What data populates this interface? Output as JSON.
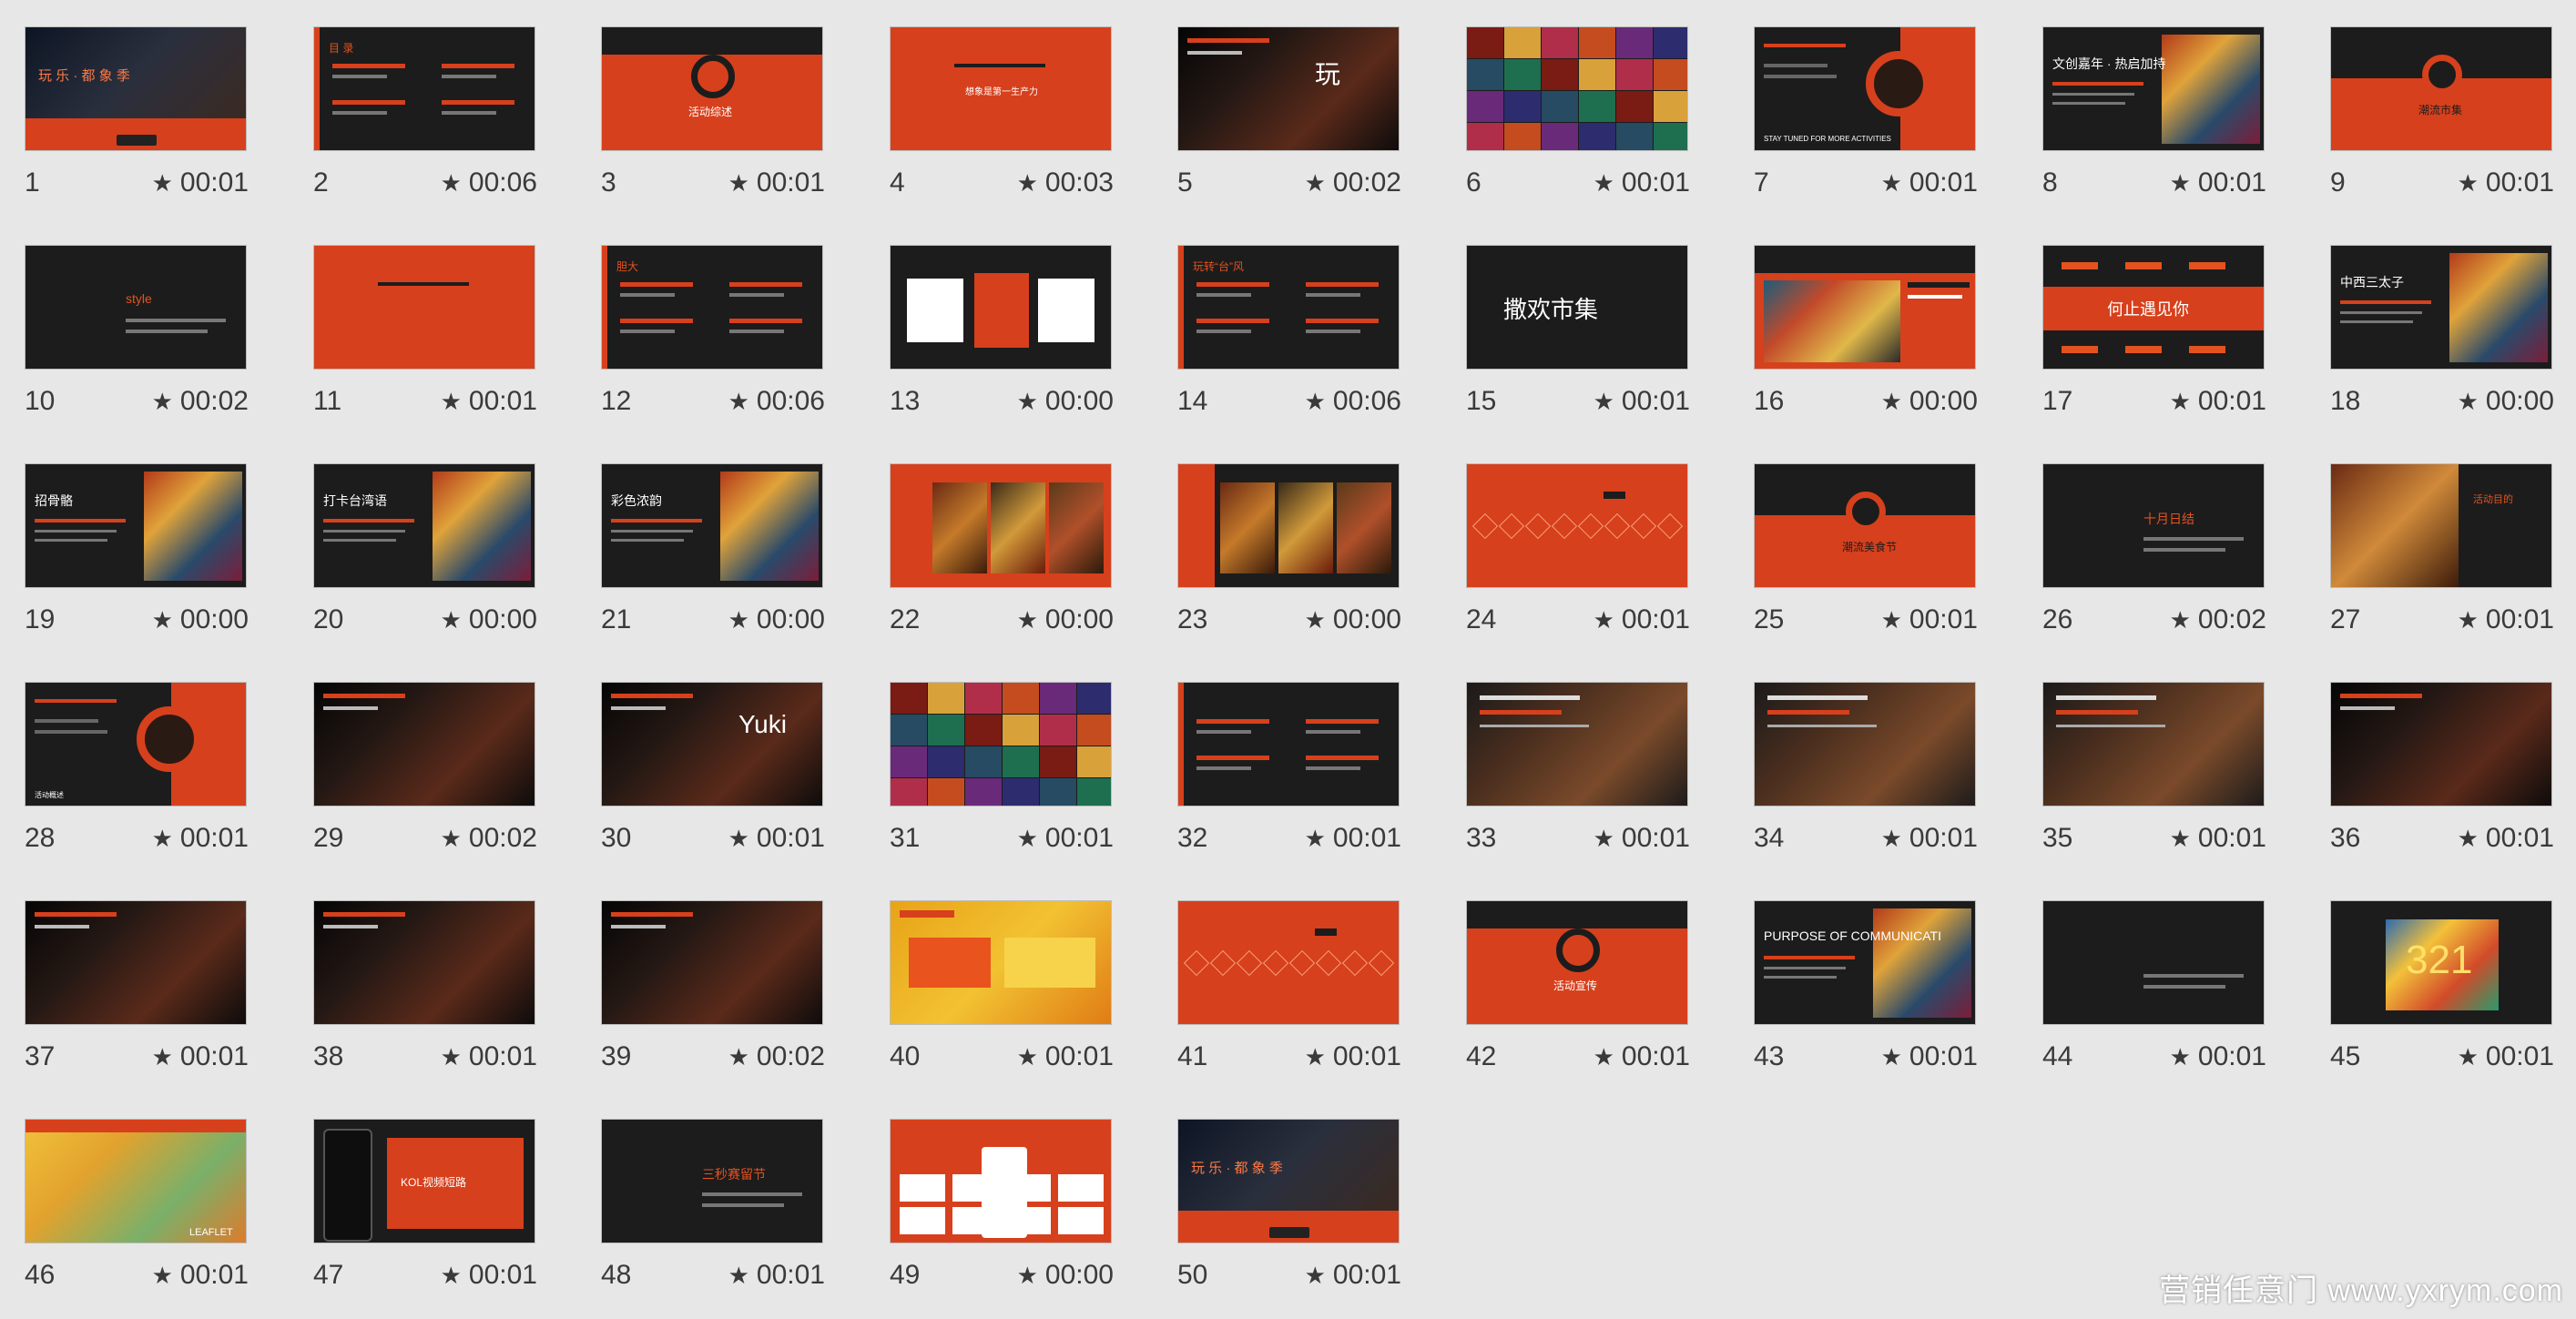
{
  "watermark": "营销任意门 www.yxrym.com",
  "slides": [
    {
      "n": "1",
      "time": "00:01",
      "style": "hero",
      "text": "玩 乐 · 都 象 季"
    },
    {
      "n": "2",
      "time": "00:06",
      "style": "dark-list",
      "text": "目 录"
    },
    {
      "n": "3",
      "time": "00:01",
      "style": "orange-ring",
      "text": "活动综述"
    },
    {
      "n": "4",
      "time": "00:03",
      "style": "orange-title",
      "text": "想象是第一生产力"
    },
    {
      "n": "5",
      "time": "00:02",
      "style": "night",
      "text": "玩"
    },
    {
      "n": "6",
      "time": "00:01",
      "style": "collage",
      "text": ""
    },
    {
      "n": "7",
      "time": "00:01",
      "style": "dark-ring",
      "text": "STAY TUNED FOR MORE ACTIVITIES"
    },
    {
      "n": "8",
      "time": "00:01",
      "style": "dark-photo",
      "text": "文创嘉年 · 热启加持"
    },
    {
      "n": "9",
      "time": "00:01",
      "style": "dark-ring-center",
      "text": "潮流市集"
    },
    {
      "n": "10",
      "time": "00:02",
      "style": "dark-arc",
      "text": "style"
    },
    {
      "n": "11",
      "time": "00:01",
      "style": "orange-title",
      "text": ""
    },
    {
      "n": "12",
      "time": "00:06",
      "style": "dark-list",
      "text": "胆大"
    },
    {
      "n": "13",
      "time": "00:00",
      "style": "cards",
      "text": ""
    },
    {
      "n": "14",
      "time": "00:06",
      "style": "dark-list",
      "text": "玩转“台”风"
    },
    {
      "n": "15",
      "time": "00:01",
      "style": "logo",
      "text": "撒欢市集"
    },
    {
      "n": "16",
      "time": "00:00",
      "style": "orange-photo",
      "text": ""
    },
    {
      "n": "17",
      "time": "00:01",
      "style": "words",
      "text": "何止遇见你"
    },
    {
      "n": "18",
      "time": "00:00",
      "style": "dark-photo-r",
      "text": "中西三太子"
    },
    {
      "n": "19",
      "time": "00:00",
      "style": "dark-photo-r",
      "text": "招骨骼"
    },
    {
      "n": "20",
      "time": "00:00",
      "style": "dark-photo-r",
      "text": "打卡台湾语"
    },
    {
      "n": "21",
      "time": "00:00",
      "style": "dark-photo-r",
      "text": "彩色浓韵"
    },
    {
      "n": "22",
      "time": "00:00",
      "style": "orange-food",
      "text": ""
    },
    {
      "n": "23",
      "time": "00:00",
      "style": "dark-food",
      "text": ""
    },
    {
      "n": "24",
      "time": "00:01",
      "style": "orange-pattern",
      "text": ""
    },
    {
      "n": "25",
      "time": "00:01",
      "style": "dark-ring-center",
      "text": "潮流美食节"
    },
    {
      "n": "26",
      "time": "00:02",
      "style": "dark-arc",
      "text": "十月日结"
    },
    {
      "n": "27",
      "time": "00:01",
      "style": "food-r",
      "text": "活动目的"
    },
    {
      "n": "28",
      "time": "00:01",
      "style": "dark-ring",
      "text": "活动概述"
    },
    {
      "n": "29",
      "time": "00:02",
      "style": "city",
      "text": ""
    },
    {
      "n": "30",
      "time": "00:01",
      "style": "night-photo",
      "text": "Yuki"
    },
    {
      "n": "31",
      "time": "00:01",
      "style": "lights",
      "text": ""
    },
    {
      "n": "32",
      "time": "00:01",
      "style": "dark-list",
      "text": ""
    },
    {
      "n": "33",
      "time": "00:01",
      "style": "food-dark",
      "text": ""
    },
    {
      "n": "34",
      "time": "00:01",
      "style": "food-dark",
      "text": ""
    },
    {
      "n": "35",
      "time": "00:01",
      "style": "food-dark",
      "text": ""
    },
    {
      "n": "36",
      "time": "00:01",
      "style": "night-photo",
      "text": ""
    },
    {
      "n": "37",
      "time": "00:01",
      "style": "night-photo",
      "text": ""
    },
    {
      "n": "38",
      "time": "00:01",
      "style": "night-photo",
      "text": ""
    },
    {
      "n": "39",
      "time": "00:02",
      "style": "city",
      "text": ""
    },
    {
      "n": "40",
      "time": "00:01",
      "style": "yellow",
      "text": ""
    },
    {
      "n": "41",
      "time": "00:01",
      "style": "orange-pattern",
      "text": ""
    },
    {
      "n": "42",
      "time": "00:01",
      "style": "orange-ring",
      "text": "活动宣传"
    },
    {
      "n": "43",
      "time": "00:01",
      "style": "dark-photo-r",
      "text": "PURPOSE OF COMMUNICATI"
    },
    {
      "n": "44",
      "time": "00:01",
      "style": "dark-arc",
      "text": ""
    },
    {
      "n": "45",
      "time": "00:01",
      "style": "dark-321",
      "text": "321"
    },
    {
      "n": "46",
      "time": "00:01",
      "style": "map",
      "text": "LEAFLET"
    },
    {
      "n": "47",
      "time": "00:01",
      "style": "phone",
      "text": "KOL视频短路"
    },
    {
      "n": "48",
      "time": "00:01",
      "style": "dark-arc",
      "text": "三秒赛留节"
    },
    {
      "n": "49",
      "time": "00:00",
      "style": "logos",
      "text": ""
    },
    {
      "n": "50",
      "time": "00:01",
      "style": "hero-end",
      "text": "玩 乐 · 都 象 季"
    }
  ]
}
